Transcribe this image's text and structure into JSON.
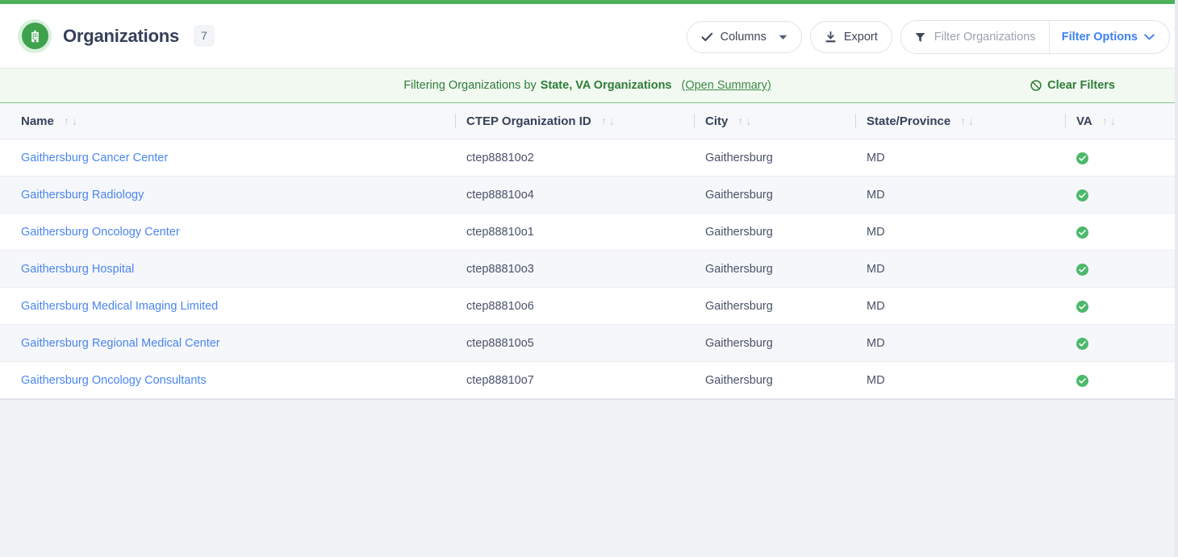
{
  "theme": {
    "accent_green": "#4cb05a",
    "link_blue": "#4a86ef",
    "banner_green_text": "#2e7d38",
    "banner_bg": "#f2f9f1",
    "check_green": "#4cb96b"
  },
  "header": {
    "title": "Organizations",
    "count": "7",
    "avatar_icon": "building-icon",
    "columns_button": {
      "label": "Columns",
      "icon": "check-icon",
      "caret": "▾"
    },
    "export_button": {
      "label": "Export",
      "icon": "download-icon"
    },
    "filter_search": {
      "placeholder": "Filter Organizations...",
      "value": "",
      "icon": "funnel-icon"
    },
    "filter_options": {
      "label": "Filter Options",
      "caret": "chevron-down-icon"
    }
  },
  "filter_banner": {
    "prefix": "Filtering Organizations by",
    "criteria": "State, VA Organizations",
    "summary_link": "(Open Summary)",
    "clear_filters": "Clear Filters",
    "clear_icon": "ban-icon"
  },
  "table": {
    "columns": [
      {
        "label": "Name",
        "sort_asc": "↑",
        "sort_desc": "↓"
      },
      {
        "label": "CTEP Organization ID",
        "sort_asc": "↑",
        "sort_desc": "↓"
      },
      {
        "label": "City",
        "sort_asc": "↑",
        "sort_desc": "↓"
      },
      {
        "label": "State/Province",
        "sort_asc": "↑",
        "sort_desc": "↓"
      },
      {
        "label": "VA",
        "sort_asc": "↑",
        "sort_desc": "↓"
      }
    ],
    "rows": [
      {
        "name": "Gaithersburg Cancer Center",
        "ctep_id": "ctep88810o2",
        "city": "Gaithersburg",
        "state": "MD",
        "va": true
      },
      {
        "name": "Gaithersburg Radiology",
        "ctep_id": "ctep88810o4",
        "city": "Gaithersburg",
        "state": "MD",
        "va": true
      },
      {
        "name": "Gaithersburg Oncology Center",
        "ctep_id": "ctep88810o1",
        "city": "Gaithersburg",
        "state": "MD",
        "va": true
      },
      {
        "name": "Gaithersburg Hospital",
        "ctep_id": "ctep88810o3",
        "city": "Gaithersburg",
        "state": "MD",
        "va": true
      },
      {
        "name": "Gaithersburg Medical Imaging Limited",
        "ctep_id": "ctep88810o6",
        "city": "Gaithersburg",
        "state": "MD",
        "va": true
      },
      {
        "name": "Gaithersburg Regional Medical Center",
        "ctep_id": "ctep88810o5",
        "city": "Gaithersburg",
        "state": "MD",
        "va": true
      },
      {
        "name": "Gaithersburg Oncology Consultants",
        "ctep_id": "ctep88810o7",
        "city": "Gaithersburg",
        "state": "MD",
        "va": true
      }
    ]
  }
}
